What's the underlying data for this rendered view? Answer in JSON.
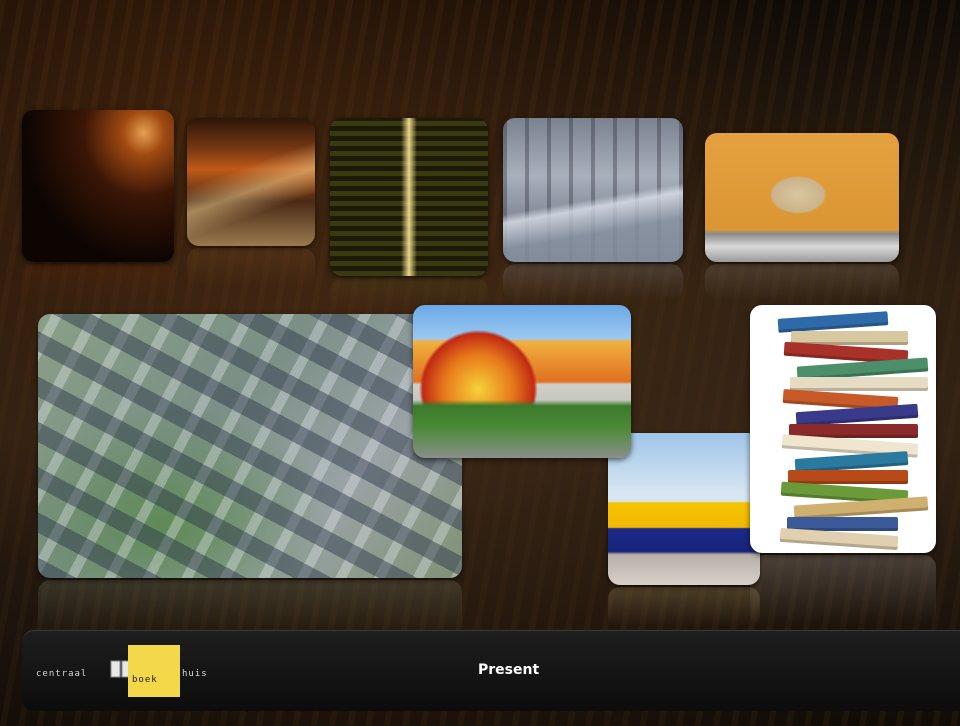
{
  "slideshow": {
    "thumbnails": [
      {
        "name": "warehouse-dark-thumbnail"
      },
      {
        "name": "conveyor-crates-thumbnail"
      },
      {
        "name": "shelving-aisle-thumbnail"
      },
      {
        "name": "sorting-machine-thumbnail"
      },
      {
        "name": "cardboard-box-conveyor-thumbnail"
      }
    ],
    "featured": [
      {
        "name": "aerial-view-photo"
      },
      {
        "name": "building-mural-photo"
      },
      {
        "name": "delivery-truck-photo"
      },
      {
        "name": "book-stack-photo"
      }
    ]
  },
  "bottom_bar": {
    "logo": {
      "word_left": "centraal",
      "word_box": "boek",
      "word_right": "huis",
      "box_color": "#f3d84a"
    },
    "present_label": "Present"
  },
  "book_colors": [
    "#2f6aa8",
    "#d8c8a0",
    "#a8322a",
    "#4c8f6a",
    "#e6dcc4",
    "#c85a2a",
    "#3a3a8a",
    "#8a2a2a",
    "#f0e6d0",
    "#2a7aa0",
    "#b84a1a",
    "#6a9a3a",
    "#d0b070",
    "#3a5a9a",
    "#e0d0b0"
  ]
}
